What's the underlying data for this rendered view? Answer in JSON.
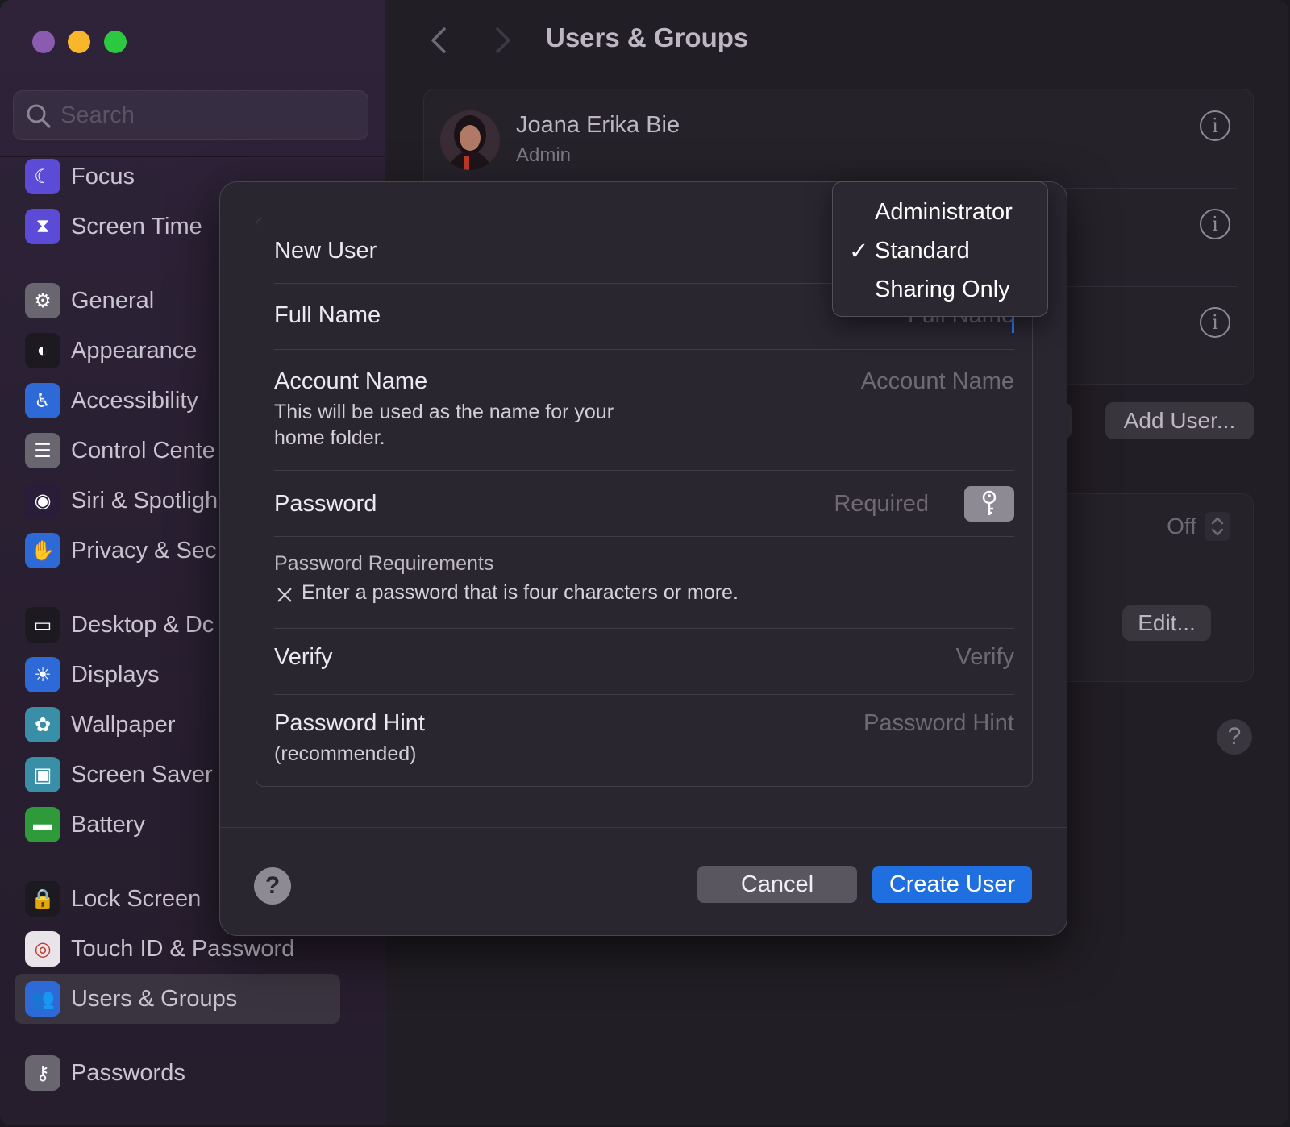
{
  "window": {
    "colors": {
      "close": "#8a5bb0",
      "minimize": "#f8b62a",
      "maximize": "#2bc840",
      "accent": "#1f6fe0"
    }
  },
  "sidebar": {
    "search_placeholder": "Search",
    "items": [
      {
        "label": "Focus",
        "icon": "moon-icon",
        "color": "#5c4bd6"
      },
      {
        "label": "Screen Time",
        "icon": "hourglass-icon",
        "color": "#5c4bd6"
      },
      {
        "label": "General",
        "icon": "gear-icon",
        "color": "#6a6670"
      },
      {
        "label": "Appearance",
        "icon": "appearance-icon",
        "color": "#1c1a20"
      },
      {
        "label": "Accessibility",
        "icon": "accessibility-icon",
        "color": "#2d6ad8"
      },
      {
        "label": "Control Cente",
        "icon": "toggles-icon",
        "color": "#6a6670"
      },
      {
        "label": "Siri & Spotligh",
        "icon": "siri-icon",
        "color": "#2a1d3a"
      },
      {
        "label": "Privacy & Sec",
        "icon": "hand-icon",
        "color": "#2d6ad8"
      },
      {
        "label": "Desktop & Dc",
        "icon": "dock-icon",
        "color": "#1c1a20"
      },
      {
        "label": "Displays",
        "icon": "sun-icon",
        "color": "#2d6ad8"
      },
      {
        "label": "Wallpaper",
        "icon": "flower-icon",
        "color": "#3a8fa8"
      },
      {
        "label": "Screen Saver",
        "icon": "screensaver-icon",
        "color": "#3a8fa8"
      },
      {
        "label": "Battery",
        "icon": "battery-icon",
        "color": "#2f9a3a"
      },
      {
        "label": "Lock Screen",
        "icon": "lock-icon",
        "color": "#1c1a20"
      },
      {
        "label": "Touch ID & Password",
        "icon": "fingerprint-icon",
        "color": "#e8e4ea"
      },
      {
        "label": "Users & Groups",
        "icon": "users-icon",
        "color": "#2d6ad8"
      },
      {
        "label": "Passwords",
        "icon": "key-icon",
        "color": "#6a6670"
      }
    ]
  },
  "main": {
    "title": "Users & Groups",
    "user": {
      "name": "Joana Erika Bie",
      "role": "Admin"
    },
    "add_user_label": "Add User...",
    "partial_button_label": ".",
    "off_label": "Off",
    "edit_label": "Edit..."
  },
  "dialog": {
    "new_user_label": "New User",
    "full_name_label": "Full Name",
    "full_name_placeholder": "Full Name",
    "account_name_label": "Account Name",
    "account_name_placeholder": "Account Name",
    "account_name_help_1": "This will be used as the name for your",
    "account_name_help_2": "home folder.",
    "password_label": "Password",
    "password_placeholder": "Required",
    "requirements_title": "Password Requirements",
    "requirement_1": "Enter a password that is four characters or more.",
    "verify_label": "Verify",
    "verify_placeholder": "Verify",
    "hint_label": "Password Hint",
    "hint_sub": "(recommended)",
    "hint_placeholder": "Password Hint",
    "help_label": "?",
    "cancel_label": "Cancel",
    "create_label": "Create User"
  },
  "account_type_menu": {
    "options": [
      "Administrator",
      "Standard",
      "Sharing Only"
    ],
    "selected": "Standard",
    "check_mark": "✓"
  }
}
